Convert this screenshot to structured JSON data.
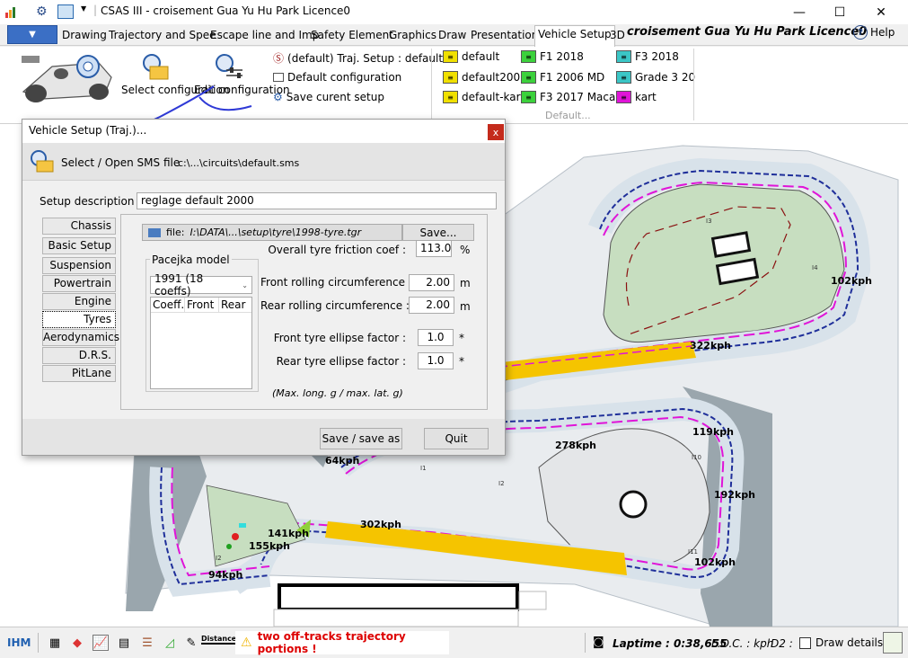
{
  "window": {
    "title": "CSAS III - croisement Gua Yu Hu Park Licence0",
    "controls": {
      "minimize": "—",
      "maximize": "☐",
      "close": "✕"
    }
  },
  "menu": {
    "tabs": [
      "Drawing",
      "Trajectory and Spee",
      "Escape line and Imp",
      "Safety Element",
      "Graphics",
      "Draw",
      "Presentation",
      "Vehicle Setup",
      "3D"
    ],
    "active_tab": "Vehicle Setup",
    "circuit_title": "croisement Gua Yu Hu Park Licence0",
    "help": "Help"
  },
  "ribbon": {
    "select_config": "Select configuration",
    "edit_config": "Edit configuration",
    "traj_setup": "(default) Traj. Setup : default",
    "default_config": "Default configuration",
    "save_setup": "Save curent setup",
    "presets_col1": [
      "default",
      "default200",
      "default-kart"
    ],
    "presets_col2": [
      "F1 2018",
      "F1 2006 MD",
      "F3 2017 Macau"
    ],
    "presets_col3": [
      "F3 2018",
      "Grade 3 20",
      "kart"
    ],
    "group_caption": "Default...",
    "colors": {
      "yellow": "#f0e000",
      "green": "#3cd13c",
      "cyan": "#3bc6c6",
      "magenta": "#e014d8"
    }
  },
  "dialog": {
    "title": "Vehicle Setup (Traj.)...",
    "close": "x",
    "open_sms": "Select / Open SMS file",
    "sms_path": "c:\\...\\circuits\\default.sms",
    "setup_desc_label": "Setup description :",
    "setup_desc_value": "reglage default 2000",
    "side_tabs": [
      "Chassis",
      "Basic Setup",
      "Suspension",
      "Powertrain",
      "Engine",
      "Tyres",
      "Aerodynamics",
      "D.R.S.",
      "PitLane"
    ],
    "active_side_tab": "Tyres",
    "file_label": "file:",
    "file_path": "I:\\DATA\\...\\setup\\tyre\\1998-tyre.tgr",
    "save_small": "Save...",
    "friction_label": "Overall tyre friction coef :",
    "friction_value": "113.0",
    "friction_unit": "%",
    "pacejka_label": "Pacejka model",
    "pacejka_value": "1991 (18 coeffs)",
    "coeff_cols": [
      "Coeff.",
      "Front",
      "Rear"
    ],
    "front_roll_label": "Front rolling circumference :",
    "front_roll_value": "2.00",
    "rear_roll_label": "Rear rolling circumference :",
    "rear_roll_value": "2.00",
    "roll_unit": "m",
    "front_ellipse_label": "Front tyre ellipse factor :",
    "front_ellipse_value": "1.0",
    "rear_ellipse_label": "Rear tyre ellipse factor :",
    "rear_ellipse_value": "1.0",
    "ellipse_unit": "*",
    "ellipse_note": "(Max. long. g / max. lat. g)",
    "save_as": "Save / save as",
    "quit": "Quit"
  },
  "track": {
    "speeds": [
      "102kph",
      "322kph",
      "278kph",
      "119kph",
      "64kph",
      "192kph",
      "302kph",
      "141kph",
      "155kph",
      "94kph",
      "102kph"
    ],
    "turn_labels": [
      "I3",
      "I4",
      "I10",
      "I11",
      "I2",
      "I1",
      "I2"
    ]
  },
  "status": {
    "ihm": "IHM",
    "warning": "two off-tracks trajectory portions !",
    "laptime": "Laptime : 0:38,655",
    "loc": "L.O.C. : kph",
    "d2": "D2 :",
    "draw_details": "Draw details",
    "distance_icon": "Distance"
  }
}
